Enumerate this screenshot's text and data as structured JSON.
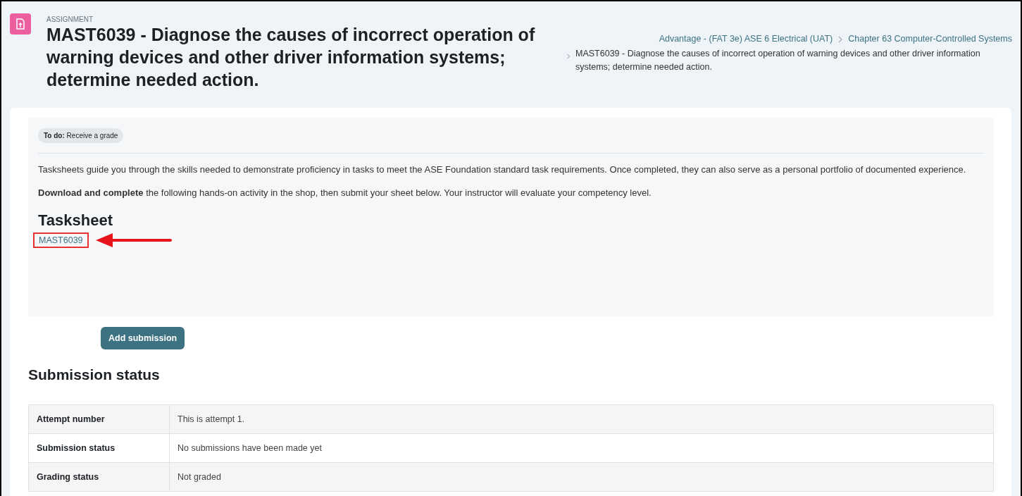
{
  "header": {
    "kind_label": "ASSIGNMENT",
    "title": "MAST6039 - Diagnose the causes of incorrect operation of warning devices and other driver information systems; determine needed action.",
    "breadcrumb": [
      {
        "text": "Advantage - (FAT 3e) ASE 6 Electrical (UAT)",
        "link": true
      },
      {
        "text": "Chapter 63 Computer-Controlled Systems",
        "link": true
      },
      {
        "text": "MAST6039 - Diagnose the causes of incorrect operation of warning devices and other driver information systems; determine needed action.",
        "link": false
      }
    ]
  },
  "activity": {
    "todo": {
      "label": "To do:",
      "value": "Receive a grade"
    },
    "paragraphs": [
      "Tasksheets guide you through the skills needed to demonstrate proficiency in tasks to meet the ASE Foundation standard task requirements. Once completed, they can also serve as a personal portfolio of documented experience.",
      "**Download and complete** the following hands-on activity in the shop, then submit your sheet below. Your instructor will evaluate your competency level."
    ],
    "heading": "Tasksheet",
    "file_link": {
      "text": "MAST6039",
      "annotated": true
    }
  },
  "add_button": "Add submission",
  "status": {
    "heading": "Submission status",
    "rows": [
      {
        "label": "Attempt number",
        "value": "This is attempt 1."
      },
      {
        "label": "Submission status",
        "value": "No submissions have been made yet"
      },
      {
        "label": "Grading status",
        "value": "Not graded"
      }
    ]
  }
}
